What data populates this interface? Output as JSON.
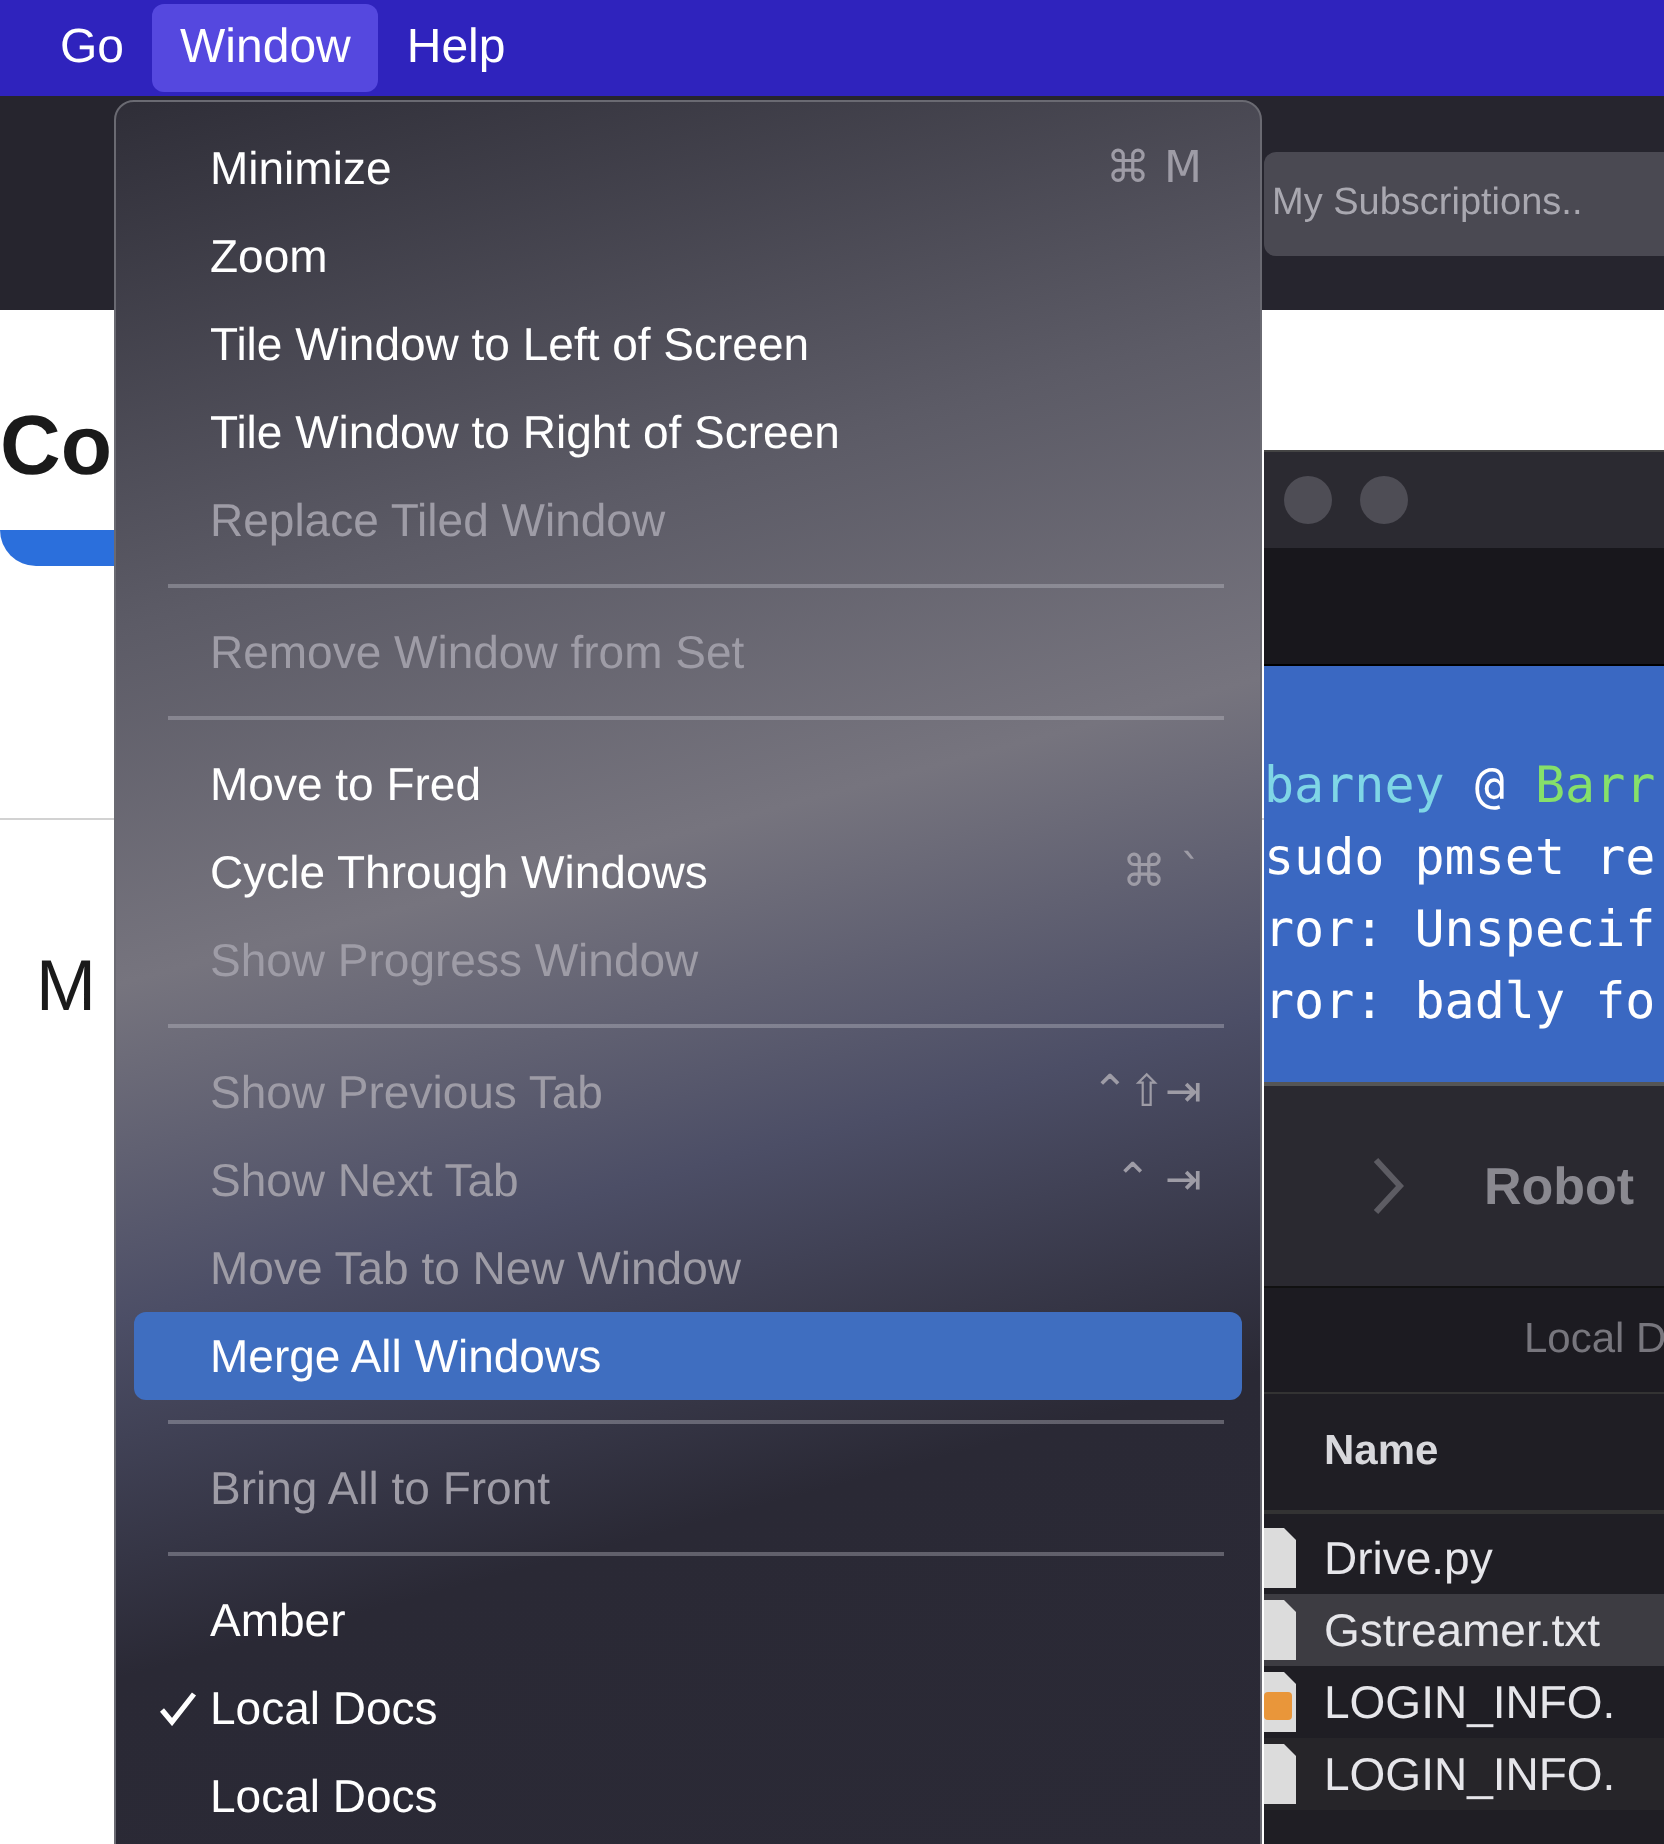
{
  "menubar": [
    {
      "label": "Go",
      "selected": false
    },
    {
      "label": "Window",
      "selected": true
    },
    {
      "label": "Help",
      "selected": false
    }
  ],
  "browser": {
    "search_field": "My Subscriptions..",
    "heading": "Co",
    "text": "M"
  },
  "terminal": {
    "lines": [
      {
        "kind": "prompt",
        "user": "barney",
        "at": "@",
        "host": "Barr"
      },
      {
        "kind": "plain",
        "text": "sudo pmset re"
      },
      {
        "kind": "plain",
        "text": "ror: Unspecif"
      },
      {
        "kind": "plain",
        "text": "ror: badly fo"
      }
    ]
  },
  "finder": {
    "title": "Robot",
    "tab": "Local D",
    "column": "Name",
    "files": [
      {
        "name": "Drive.py",
        "kind": "document",
        "selected": false
      },
      {
        "name": "Gstreamer.txt",
        "kind": "document",
        "selected": true
      },
      {
        "name": "LOGIN_INFO.",
        "kind": "pages",
        "selected": false
      },
      {
        "name": "LOGIN_INFO.",
        "kind": "document",
        "selected": false
      }
    ]
  },
  "menu": [
    {
      "kind": "item",
      "label": "Minimize",
      "shortcut": "⌘ M",
      "disabled": false,
      "checked": false,
      "highlighted": false
    },
    {
      "kind": "item",
      "label": "Zoom",
      "disabled": false,
      "checked": false,
      "highlighted": false
    },
    {
      "kind": "item",
      "label": "Tile Window to Left of Screen",
      "disabled": false,
      "checked": false,
      "highlighted": false
    },
    {
      "kind": "item",
      "label": "Tile Window to Right of Screen",
      "disabled": false,
      "checked": false,
      "highlighted": false
    },
    {
      "kind": "item",
      "label": "Replace Tiled Window",
      "disabled": true,
      "checked": false,
      "highlighted": false
    },
    {
      "kind": "separator"
    },
    {
      "kind": "item",
      "label": "Remove Window from Set",
      "disabled": true,
      "checked": false,
      "highlighted": false
    },
    {
      "kind": "separator"
    },
    {
      "kind": "item",
      "label": "Move to Fred",
      "disabled": false,
      "checked": false,
      "highlighted": false
    },
    {
      "kind": "item",
      "label": "Cycle Through Windows",
      "shortcut": "⌘ `",
      "disabled": false,
      "checked": false,
      "highlighted": false
    },
    {
      "kind": "item",
      "label": "Show Progress Window",
      "disabled": true,
      "checked": false,
      "highlighted": false
    },
    {
      "kind": "separator"
    },
    {
      "kind": "item",
      "label": "Show Previous Tab",
      "shortcut": "⌃⇧⇥",
      "disabled": true,
      "checked": false,
      "highlighted": false
    },
    {
      "kind": "item",
      "label": "Show Next Tab",
      "shortcut": "⌃ ⇥",
      "disabled": true,
      "checked": false,
      "highlighted": false
    },
    {
      "kind": "item",
      "label": "Move Tab to New Window",
      "disabled": true,
      "checked": false,
      "highlighted": false
    },
    {
      "kind": "item",
      "label": "Merge All Windows",
      "disabled": false,
      "checked": false,
      "highlighted": true
    },
    {
      "kind": "separator"
    },
    {
      "kind": "item",
      "label": "Bring All to Front",
      "disabled": true,
      "checked": false,
      "highlighted": false
    },
    {
      "kind": "separator"
    },
    {
      "kind": "item",
      "label": "Amber",
      "disabled": false,
      "checked": false,
      "highlighted": false
    },
    {
      "kind": "item",
      "label": "Local Docs",
      "disabled": false,
      "checked": true,
      "highlighted": false
    },
    {
      "kind": "item",
      "label": "Local Docs",
      "disabled": false,
      "checked": false,
      "highlighted": false
    }
  ]
}
